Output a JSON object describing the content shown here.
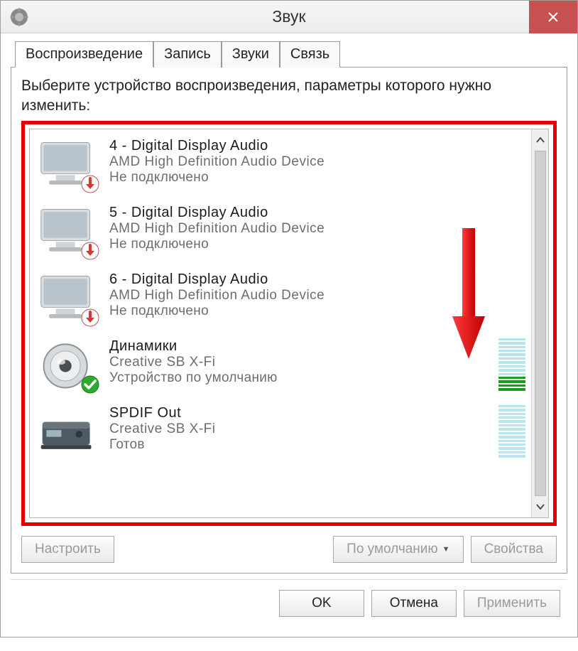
{
  "window": {
    "title": "Звук"
  },
  "tabs": [
    {
      "label": "Воспроизведение",
      "active": true
    },
    {
      "label": "Запись",
      "active": false
    },
    {
      "label": "Звуки",
      "active": false
    },
    {
      "label": "Связь",
      "active": false
    }
  ],
  "instruction": "Выберите устройство воспроизведения, параметры которого нужно изменить:",
  "devices": [
    {
      "title": "4 - Digital Display Audio",
      "subtitle": "AMD High Definition Audio Device",
      "status": "Не подключено",
      "icon": "monitor",
      "badge": "unplugged",
      "meter": null
    },
    {
      "title": "5 - Digital Display Audio",
      "subtitle": "AMD High Definition Audio Device",
      "status": "Не подключено",
      "icon": "monitor",
      "badge": "unplugged",
      "meter": null
    },
    {
      "title": "6 - Digital Display Audio",
      "subtitle": "AMD High Definition Audio Device",
      "status": "Не подключено",
      "icon": "monitor",
      "badge": "unplugged",
      "meter": null
    },
    {
      "title": "Динамики",
      "subtitle": "Creative SB X-Fi",
      "status": "Устройство по умолчанию",
      "icon": "speaker",
      "badge": "default",
      "meter": {
        "total": 14,
        "active": 4
      }
    },
    {
      "title": "SPDIF Out",
      "subtitle": "Creative SB X-Fi",
      "status": "Готов",
      "icon": "digital",
      "badge": null,
      "meter": {
        "total": 14,
        "active": 0
      }
    }
  ],
  "panel_buttons": {
    "configure": "Настроить",
    "set_default": "По умолчанию",
    "properties": "Свойства"
  },
  "dialog_buttons": {
    "ok": "OK",
    "cancel": "Отмена",
    "apply": "Применить"
  }
}
